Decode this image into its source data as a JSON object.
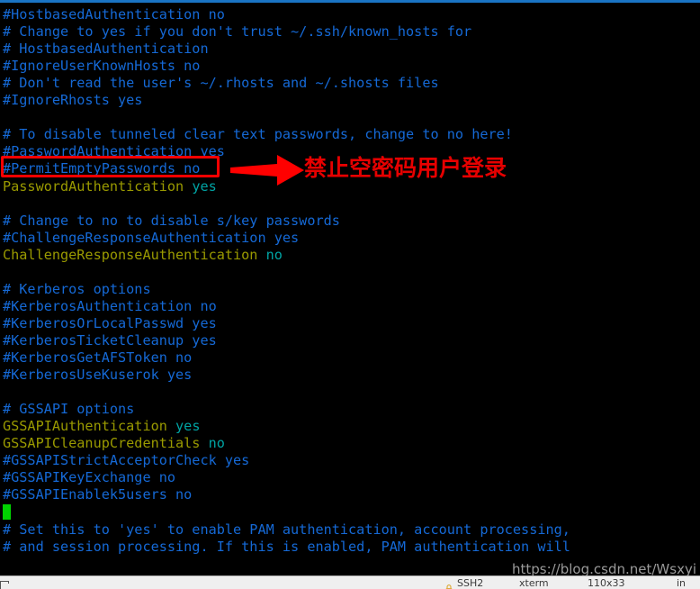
{
  "window": {
    "title_bar_color": "#1a74c4"
  },
  "terminal": {
    "background": "#000000",
    "comment_color": "#1569d6",
    "directive_color": "#9a9a00",
    "value_color": "#00a4a4",
    "cursor_color": "#00d200",
    "lines": [
      {
        "kind": "comment",
        "text": "#HostbasedAuthentication no"
      },
      {
        "kind": "comment",
        "text": "# Change to yes if you don't trust ~/.ssh/known_hosts for"
      },
      {
        "kind": "comment",
        "text": "# HostbasedAuthentication"
      },
      {
        "kind": "comment",
        "text": "#IgnoreUserKnownHosts no"
      },
      {
        "kind": "comment",
        "text": "# Don't read the user's ~/.rhosts and ~/.shosts files"
      },
      {
        "kind": "comment",
        "text": "#IgnoreRhosts yes"
      },
      {
        "kind": "blank",
        "text": ""
      },
      {
        "kind": "comment",
        "text": "# To disable tunneled clear text passwords, change to no here!"
      },
      {
        "kind": "comment",
        "text": "#PasswordAuthentication yes"
      },
      {
        "kind": "comment",
        "text": "#PermitEmptyPasswords no"
      },
      {
        "kind": "setting",
        "key": "PasswordAuthentication",
        "value": "yes"
      },
      {
        "kind": "blank",
        "text": ""
      },
      {
        "kind": "comment",
        "text": "# Change to no to disable s/key passwords"
      },
      {
        "kind": "comment",
        "text": "#ChallengeResponseAuthentication yes"
      },
      {
        "kind": "setting",
        "key": "ChallengeResponseAuthentication",
        "value": "no"
      },
      {
        "kind": "blank",
        "text": ""
      },
      {
        "kind": "comment",
        "text": "# Kerberos options"
      },
      {
        "kind": "comment",
        "text": "#KerberosAuthentication no"
      },
      {
        "kind": "comment",
        "text": "#KerberosOrLocalPasswd yes"
      },
      {
        "kind": "comment",
        "text": "#KerberosTicketCleanup yes"
      },
      {
        "kind": "comment",
        "text": "#KerberosGetAFSToken no"
      },
      {
        "kind": "comment",
        "text": "#KerberosUseKuserok yes"
      },
      {
        "kind": "blank",
        "text": ""
      },
      {
        "kind": "comment",
        "text": "# GSSAPI options"
      },
      {
        "kind": "setting",
        "key": "GSSAPIAuthentication",
        "value": "yes"
      },
      {
        "kind": "setting",
        "key": "GSSAPICleanupCredentials",
        "value": "no"
      },
      {
        "kind": "comment",
        "text": "#GSSAPIStrictAcceptorCheck yes"
      },
      {
        "kind": "comment",
        "text": "#GSSAPIKeyExchange no"
      },
      {
        "kind": "comment",
        "text": "#GSSAPIEnablek5users no"
      },
      {
        "kind": "cursor",
        "text": ""
      },
      {
        "kind": "comment",
        "text": "# Set this to 'yes' to enable PAM authentication, account processing,"
      },
      {
        "kind": "comment",
        "text": "# and session processing. If this is enabled, PAM authentication will"
      }
    ]
  },
  "annotation": {
    "text": "禁止空密码用户登录",
    "color": "#e60000",
    "arrow_name": "right-arrow",
    "box_target_line": "#PermitEmptyPasswords no"
  },
  "watermark": {
    "text": "https://blog.csdn.net/Wsxyi",
    "color": "#9a9a9a"
  },
  "statusbar": {
    "protocol": "SSH2",
    "terminal_type": "xterm",
    "size": "110x33",
    "tail": "in",
    "lock_icon": "lock-icon",
    "size_icon": "resize-icon"
  }
}
